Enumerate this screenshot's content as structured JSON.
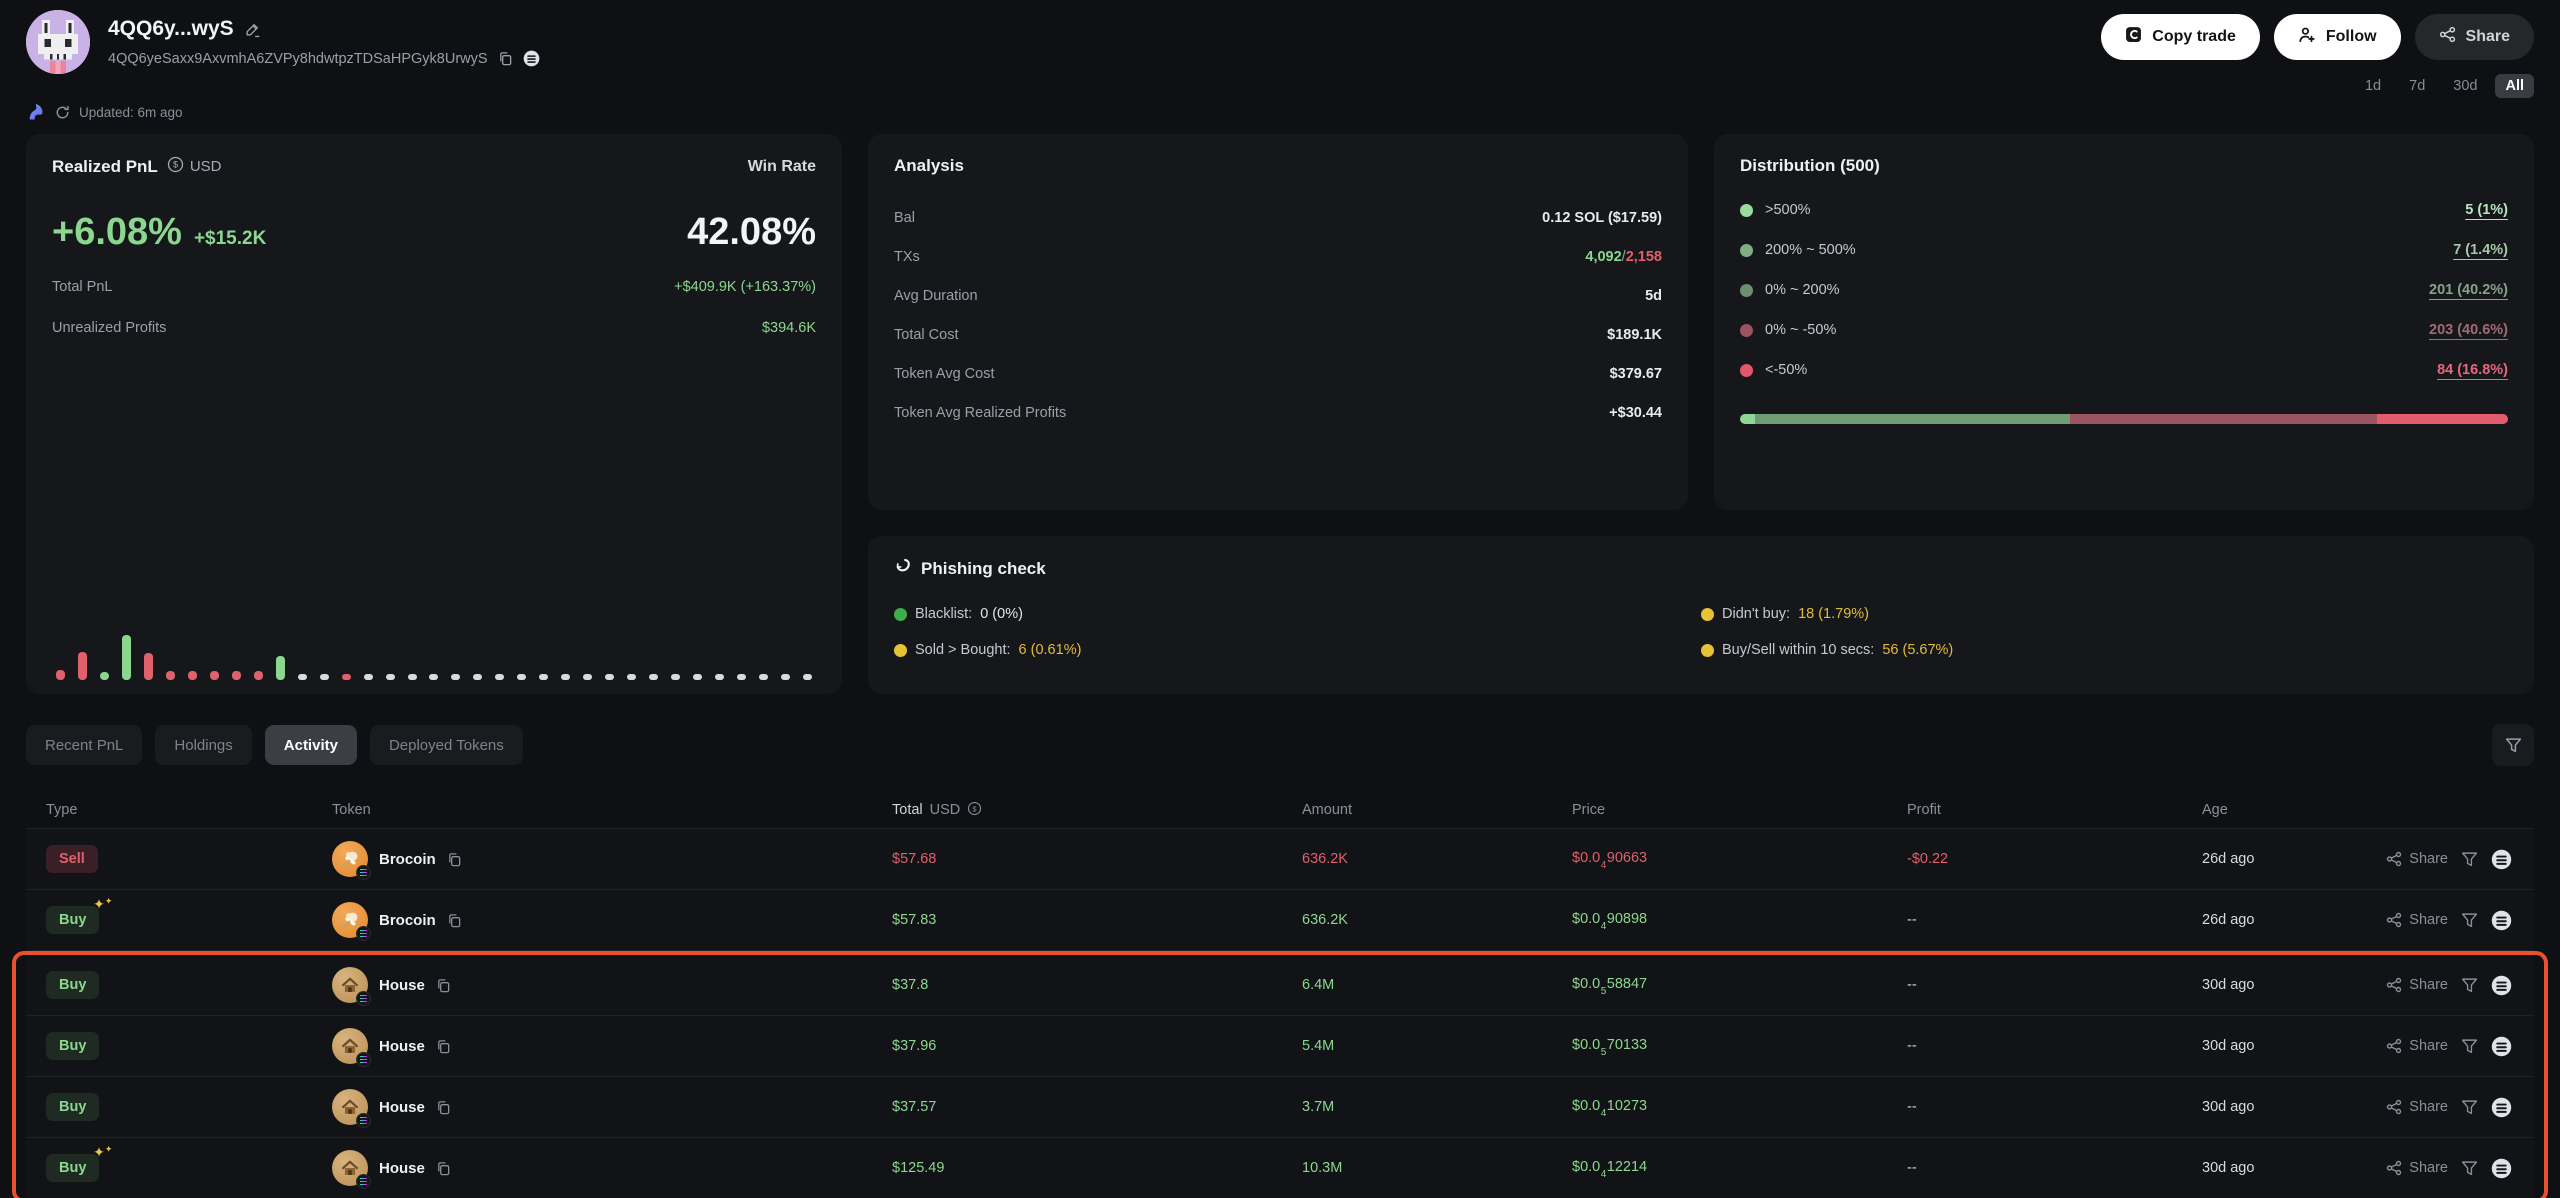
{
  "header": {
    "wallet_name": "4QQ6y...wyS",
    "wallet_address": "4QQ6yeSaxx9AxvmhA6ZVPy8hdwtpzTDSaHPGyk8UrwyS",
    "buttons": {
      "copy_trade": "Copy trade",
      "follow": "Follow",
      "share": "Share"
    },
    "time_filters": [
      {
        "label": "1d",
        "cls": ""
      },
      {
        "label": "7d",
        "cls": ""
      },
      {
        "label": "30d",
        "cls": ""
      },
      {
        "label": "All",
        "cls": "active"
      }
    ],
    "updated": "Updated: 6m ago"
  },
  "realized_pnl": {
    "title": "Realized PnL",
    "currency": "USD",
    "pnl_percent": "+6.08%",
    "pnl_amount": "+$15.2K",
    "win_rate_label": "Win Rate",
    "win_rate_value": "42.08%",
    "stats": [
      {
        "label": "Total PnL",
        "value": "+$409.9K (+163.37%)",
        "cls": "pos"
      },
      {
        "label": "Unrealized Profits",
        "value": "$394.6K",
        "cls": "pos"
      }
    ],
    "chart_data": {
      "type": "bar",
      "title": "Daily realized PnL mini bars (oldest to newest, height = relative PnL magnitude, color = sign)",
      "values": [
        10,
        28,
        8,
        45,
        27,
        9,
        9,
        9,
        9,
        9,
        24,
        6,
        6,
        6,
        6,
        6,
        6,
        6,
        6,
        6,
        6,
        6,
        6,
        6,
        6,
        6,
        6,
        6,
        6,
        6,
        6,
        6,
        6,
        6,
        6
      ],
      "colors": [
        "red",
        "red",
        "green",
        "green",
        "red",
        "red",
        "red",
        "red",
        "red",
        "red",
        "green",
        "gray",
        "gray",
        "red",
        "gray",
        "gray",
        "gray",
        "gray",
        "gray",
        "gray",
        "gray",
        "gray",
        "gray",
        "gray",
        "gray",
        "gray",
        "gray",
        "gray",
        "gray",
        "gray",
        "gray",
        "gray",
        "gray",
        "gray",
        "gray"
      ],
      "palette": {
        "red": "#e0606c",
        "green": "#8cd790",
        "gray": "#d7dade"
      }
    }
  },
  "analysis": {
    "title": "Analysis",
    "rows": [
      {
        "label": "Bal",
        "value": "0.12 SOL ($17.59)",
        "cls": "plain"
      },
      {
        "label": "TXs",
        "tx_green": "4,092",
        "tx_sep": "/",
        "tx_red": "2,158"
      },
      {
        "label": "Avg Duration",
        "value": "5d",
        "cls": "plain"
      },
      {
        "label": "Total Cost",
        "value": "$189.1K",
        "cls": "plain"
      },
      {
        "label": "Token Avg Cost",
        "value": "$379.67",
        "cls": "plain"
      },
      {
        "label": "Token Avg Realized Profits",
        "value": "+$30.44",
        "cls": "pos"
      }
    ]
  },
  "distribution": {
    "title": "Distribution (500)",
    "rows": [
      {
        "label": ">500%",
        "value": "5 (1%)",
        "dot": "dot-g1",
        "cls": "d-g1"
      },
      {
        "label": "200% ~ 500%",
        "value": "7 (1.4%)",
        "dot": "dot-g2",
        "cls": "d-g2"
      },
      {
        "label": "0% ~ 200%",
        "value": "201 (40.2%)",
        "dot": "dot-g3",
        "cls": "d-g3"
      },
      {
        "label": "0% ~ -50%",
        "value": "203 (40.6%)",
        "dot": "dot-r2",
        "cls": "d-r2"
      },
      {
        "label": "<-50%",
        "value": "84 (16.8%)",
        "dot": "dot-r1",
        "cls": "d-r1"
      }
    ],
    "bar_segments": [
      {
        "color": "#8fd694",
        "pct": 2
      },
      {
        "color": "#6f9c74",
        "pct": 41
      },
      {
        "color": "#9c5460",
        "pct": 40
      },
      {
        "color": "#e25c6e",
        "pct": 17
      }
    ]
  },
  "phishing": {
    "title": "Phishing check",
    "left": [
      {
        "label": "Blacklist:",
        "value": "0 (0%)",
        "dot": "dot-green",
        "cls": "plain"
      },
      {
        "label": "Sold > Bought:",
        "value": "6 (0.61%)",
        "dot": "dot-yellow",
        "cls": "warn"
      }
    ],
    "right": [
      {
        "label": "Didn't buy:",
        "value": "18 (1.79%)",
        "dot": "dot-yellow",
        "cls": "warn"
      },
      {
        "label": "Buy/Sell within 10 secs:",
        "value": "56 (5.67%)",
        "dot": "dot-yellow",
        "cls": "warn"
      }
    ]
  },
  "tabs": [
    {
      "label": "Recent PnL",
      "cls": ""
    },
    {
      "label": "Holdings",
      "cls": ""
    },
    {
      "label": "Activity",
      "cls": "active"
    },
    {
      "label": "Deployed Tokens",
      "cls": ""
    }
  ],
  "table": {
    "headers": {
      "type": "Type",
      "token": "Token",
      "total": "Total",
      "total_unit": "USD",
      "amount": "Amount",
      "price": "Price",
      "profit": "Profit",
      "age": "Age"
    },
    "rows_top": [
      {
        "type": "Sell",
        "type_cls": "sell",
        "sparkle": false,
        "token": "Brocoin",
        "icon": "icon-brocoin",
        "total": "$57.68",
        "amount": "636.2K",
        "price_prefix": "$0.0",
        "price_sub": "4",
        "price_rest": "90663",
        "profit": "-$0.22",
        "profit_cls": "neg",
        "age": "26d ago",
        "cls": "neg",
        "share": "Share"
      },
      {
        "type": "Buy",
        "type_cls": "buy",
        "sparkle": true,
        "token": "Brocoin",
        "icon": "icon-brocoin",
        "total": "$57.83",
        "amount": "636.2K",
        "price_prefix": "$0.0",
        "price_sub": "4",
        "price_rest": "90898",
        "profit": "--",
        "profit_cls": "plain",
        "age": "26d ago",
        "cls": "pos",
        "share": "Share"
      }
    ],
    "rows_highlighted": [
      {
        "type": "Buy",
        "type_cls": "buy",
        "sparkle": false,
        "token": "House",
        "icon": "icon-house",
        "total": "$37.8",
        "amount": "6.4M",
        "price_prefix": "$0.0",
        "price_sub": "5",
        "price_rest": "58847",
        "profit": "--",
        "profit_cls": "plain",
        "age": "30d ago",
        "cls": "pos",
        "share": "Share"
      },
      {
        "type": "Buy",
        "type_cls": "buy",
        "sparkle": false,
        "token": "House",
        "icon": "icon-house",
        "total": "$37.96",
        "amount": "5.4M",
        "price_prefix": "$0.0",
        "price_sub": "5",
        "price_rest": "70133",
        "profit": "--",
        "profit_cls": "plain",
        "age": "30d ago",
        "cls": "pos",
        "share": "Share"
      },
      {
        "type": "Buy",
        "type_cls": "buy",
        "sparkle": false,
        "token": "House",
        "icon": "icon-house",
        "total": "$37.57",
        "amount": "3.7M",
        "price_prefix": "$0.0",
        "price_sub": "4",
        "price_rest": "10273",
        "profit": "--",
        "profit_cls": "plain",
        "age": "30d ago",
        "cls": "pos",
        "share": "Share"
      },
      {
        "type": "Buy",
        "type_cls": "buy",
        "sparkle": true,
        "token": "House",
        "icon": "icon-house",
        "total": "$125.49",
        "amount": "10.3M",
        "price_prefix": "$0.0",
        "price_sub": "4",
        "price_rest": "12214",
        "profit": "--",
        "profit_cls": "plain",
        "age": "30d ago",
        "cls": "pos",
        "share": "Share"
      }
    ]
  },
  "colors": {
    "accent_orange": "#e8502e",
    "green": "#8cd790",
    "red": "#e0606c",
    "yellow": "#e3bd3a"
  }
}
